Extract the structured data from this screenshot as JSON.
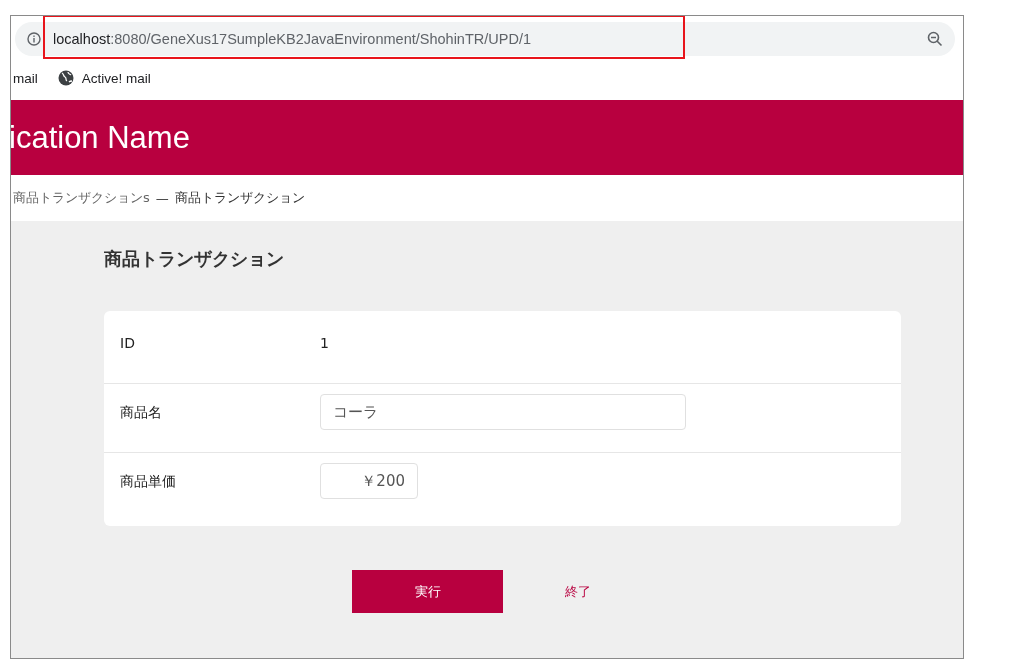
{
  "browser": {
    "url_host": "localhost",
    "url_path": ":8080/GeneXus17SumpleKB2JavaEnvironment/ShohinTR/UPD/1",
    "url_highlighted": true,
    "bookmarks": [
      {
        "label": "mail",
        "kind": "plain"
      },
      {
        "label": "Active! mail",
        "kind": "globe"
      }
    ]
  },
  "header": {
    "title": "ication Name"
  },
  "breadcrumb": {
    "link": "商品トランザクションs",
    "separator": "—",
    "current": "商品トランザクション"
  },
  "form": {
    "title": "商品トランザクション",
    "rows": [
      {
        "label": "ID",
        "kind": "text",
        "value": "1"
      },
      {
        "label": "商品名",
        "kind": "input",
        "value": "コーラ"
      },
      {
        "label": "商品単価",
        "kind": "number",
        "value": "￥200"
      }
    ]
  },
  "buttons": [
    {
      "label": "実行",
      "kind": "primary"
    },
    {
      "label": "終了",
      "kind": "link"
    }
  ]
}
